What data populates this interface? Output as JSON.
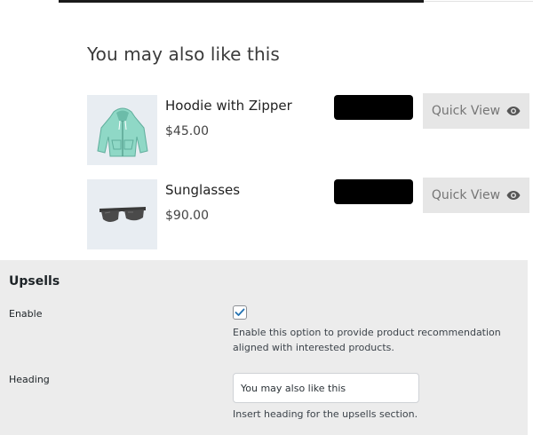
{
  "preview": {
    "heading": "You may also like this",
    "products": [
      {
        "name": "Hoodie with Zipper",
        "price": "$45.00",
        "image_icon": "hoodie-icon",
        "quick_view_label": "Quick View",
        "quick_view_icon": "eye-icon"
      },
      {
        "name": "Sunglasses",
        "price": "$90.00",
        "image_icon": "sunglasses-icon",
        "quick_view_label": "Quick View",
        "quick_view_icon": "eye-icon"
      }
    ]
  },
  "settings": {
    "section_title": "Upsells",
    "enable": {
      "label": "Enable",
      "checked": true,
      "description": "Enable this option to provide product recommendation aligned with interested products."
    },
    "heading": {
      "label": "Heading",
      "value": "You may also like this",
      "description": "Insert heading for the upsells section."
    }
  },
  "colors": {
    "cart_button": "#000000",
    "quick_view_bg": "#e6e6e6",
    "thumb_bg": "#e8edf2",
    "hoodie": "#8fd8c6",
    "checkmark": "#2271b1",
    "panel_bg": "#ececec"
  }
}
